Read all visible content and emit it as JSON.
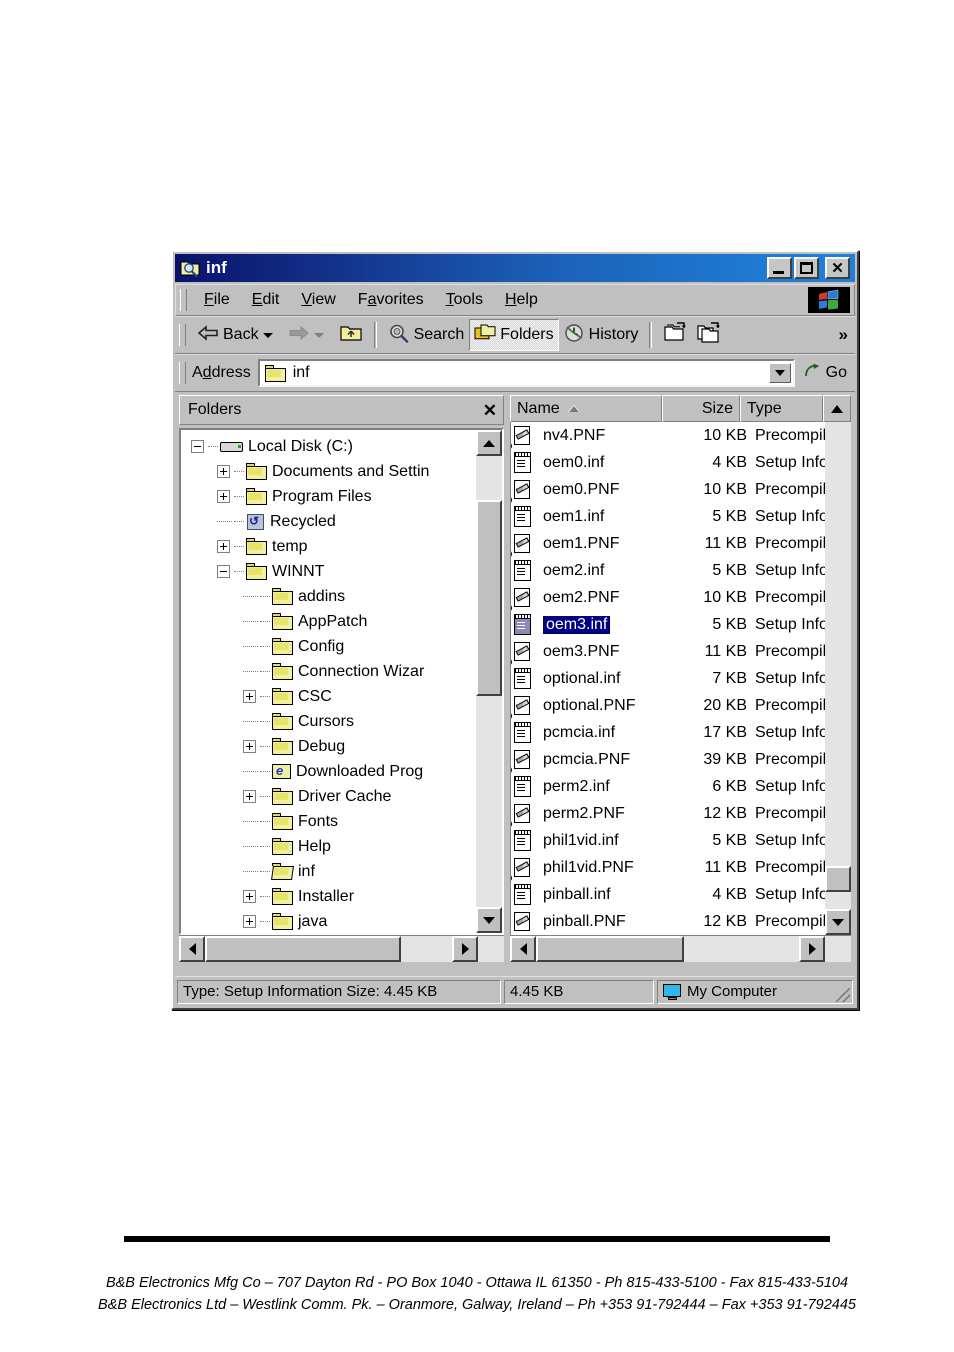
{
  "window": {
    "title": "inf",
    "title_icon": "folder-search-icon",
    "controls": {
      "minimize": "minimize-button",
      "maximize": "maximize-button",
      "close": "close-button"
    }
  },
  "menubar": {
    "items": [
      {
        "label": "File",
        "accel": "F"
      },
      {
        "label": "Edit",
        "accel": "E"
      },
      {
        "label": "View",
        "accel": "V"
      },
      {
        "label": "Favorites",
        "accel": "a"
      },
      {
        "label": "Tools",
        "accel": "T"
      },
      {
        "label": "Help",
        "accel": "H"
      }
    ],
    "logo": "windows-flag-logo"
  },
  "toolbar": {
    "back_label": "Back",
    "forward_label": "",
    "up_label": "",
    "search_label": "Search",
    "folders_label": "Folders",
    "history_label": "History",
    "move_to_label": "",
    "copy_to_label": "",
    "overflow_label": "»",
    "pressed": "Folders"
  },
  "address": {
    "label": "Address",
    "value": "inf",
    "icon": "folder-icon",
    "go_label": "Go"
  },
  "tree_panel": {
    "header_title": "Folders",
    "close_label": "✕",
    "items": [
      {
        "label": "Local Disk (C:)",
        "depth": 1,
        "expander": "minus",
        "icon": "drive-icon"
      },
      {
        "label": "Documents and Settin",
        "depth": 2,
        "expander": "plus",
        "icon": "folder-icon"
      },
      {
        "label": "Program Files",
        "depth": 2,
        "expander": "plus",
        "icon": "folder-icon"
      },
      {
        "label": "Recycled",
        "depth": 2,
        "expander": "none",
        "icon": "recycle-bin-icon"
      },
      {
        "label": "temp",
        "depth": 2,
        "expander": "plus",
        "icon": "folder-icon"
      },
      {
        "label": "WINNT",
        "depth": 2,
        "expander": "minus",
        "icon": "folder-icon"
      },
      {
        "label": "addins",
        "depth": 3,
        "expander": "none",
        "icon": "folder-icon"
      },
      {
        "label": "AppPatch",
        "depth": 3,
        "expander": "none",
        "icon": "folder-icon"
      },
      {
        "label": "Config",
        "depth": 3,
        "expander": "none",
        "icon": "folder-icon"
      },
      {
        "label": "Connection Wizar",
        "depth": 3,
        "expander": "none",
        "icon": "folder-icon"
      },
      {
        "label": "CSC",
        "depth": 3,
        "expander": "plus",
        "icon": "folder-icon"
      },
      {
        "label": "Cursors",
        "depth": 3,
        "expander": "none",
        "icon": "folder-icon"
      },
      {
        "label": "Debug",
        "depth": 3,
        "expander": "plus",
        "icon": "folder-icon"
      },
      {
        "label": "Downloaded Prog",
        "depth": 3,
        "expander": "none",
        "icon": "downloaded-program-files-icon"
      },
      {
        "label": "Driver Cache",
        "depth": 3,
        "expander": "plus",
        "icon": "folder-icon"
      },
      {
        "label": "Fonts",
        "depth": 3,
        "expander": "none",
        "icon": "folder-icon"
      },
      {
        "label": "Help",
        "depth": 3,
        "expander": "none",
        "icon": "folder-icon"
      },
      {
        "label": "inf",
        "depth": 3,
        "expander": "none",
        "icon": "open-folder-icon"
      },
      {
        "label": "Installer",
        "depth": 3,
        "expander": "plus",
        "icon": "folder-icon"
      },
      {
        "label": "java",
        "depth": 3,
        "expander": "plus",
        "icon": "folder-icon"
      }
    ]
  },
  "list_panel": {
    "columns": [
      {
        "key": "name",
        "label": "Name",
        "sort": "asc"
      },
      {
        "key": "size",
        "label": "Size",
        "sort": ""
      },
      {
        "key": "type",
        "label": "Type",
        "sort": ""
      }
    ],
    "rows": [
      {
        "name": "nv4.PNF",
        "size": "10 KB",
        "type": "Precompiled",
        "icon": "pnf-file-icon",
        "selected": false
      },
      {
        "name": "oem0.inf",
        "size": "4 KB",
        "type": "Setup Inform",
        "icon": "inf-file-icon",
        "selected": false
      },
      {
        "name": "oem0.PNF",
        "size": "10 KB",
        "type": "Precompiled",
        "icon": "pnf-file-icon",
        "selected": false
      },
      {
        "name": "oem1.inf",
        "size": "5 KB",
        "type": "Setup Inform",
        "icon": "inf-file-icon",
        "selected": false
      },
      {
        "name": "oem1.PNF",
        "size": "11 KB",
        "type": "Precompiled",
        "icon": "pnf-file-icon",
        "selected": false
      },
      {
        "name": "oem2.inf",
        "size": "5 KB",
        "type": "Setup Inform",
        "icon": "inf-file-icon",
        "selected": false
      },
      {
        "name": "oem2.PNF",
        "size": "10 KB",
        "type": "Precompiled",
        "icon": "pnf-file-icon",
        "selected": false
      },
      {
        "name": "oem3.inf",
        "size": "5 KB",
        "type": "Setup Inform",
        "icon": "inf-file-icon",
        "selected": true
      },
      {
        "name": "oem3.PNF",
        "size": "11 KB",
        "type": "Precompiled",
        "icon": "pnf-file-icon",
        "selected": false
      },
      {
        "name": "optional.inf",
        "size": "7 KB",
        "type": "Setup Inform",
        "icon": "inf-file-icon",
        "selected": false
      },
      {
        "name": "optional.PNF",
        "size": "20 KB",
        "type": "Precompiled",
        "icon": "pnf-file-icon",
        "selected": false
      },
      {
        "name": "pcmcia.inf",
        "size": "17 KB",
        "type": "Setup Inform",
        "icon": "inf-file-icon",
        "selected": false
      },
      {
        "name": "pcmcia.PNF",
        "size": "39 KB",
        "type": "Precompiled",
        "icon": "pnf-file-icon",
        "selected": false
      },
      {
        "name": "perm2.inf",
        "size": "6 KB",
        "type": "Setup Inform",
        "icon": "inf-file-icon",
        "selected": false
      },
      {
        "name": "perm2.PNF",
        "size": "12 KB",
        "type": "Precompiled",
        "icon": "pnf-file-icon",
        "selected": false
      },
      {
        "name": "phil1vid.inf",
        "size": "5 KB",
        "type": "Setup Inform",
        "icon": "inf-file-icon",
        "selected": false
      },
      {
        "name": "phil1vid.PNF",
        "size": "11 KB",
        "type": "Precompiled",
        "icon": "pnf-file-icon",
        "selected": false
      },
      {
        "name": "pinball.inf",
        "size": "4 KB",
        "type": "Setup Inform",
        "icon": "inf-file-icon",
        "selected": false
      },
      {
        "name": "pinball.PNF",
        "size": "12 KB",
        "type": "Precompiled",
        "icon": "pnf-file-icon",
        "selected": false
      }
    ]
  },
  "statusbar": {
    "type_text": "Type: Setup Information Size: 4.45 KB",
    "size_text": "4.45 KB",
    "zone_text": "My Computer",
    "zone_icon": "my-computer-icon"
  },
  "document_footer": {
    "line1": "B&B Electronics Mfg Co – 707 Dayton Rd - PO Box 1040 - Ottawa IL 61350 - Ph 815-433-5100 - Fax 815-433-5104",
    "line2": "B&B Electronics Ltd – Westlink Comm. Pk. – Oranmore, Galway, Ireland – Ph +353 91-792444 – Fax +353 91-792445"
  }
}
